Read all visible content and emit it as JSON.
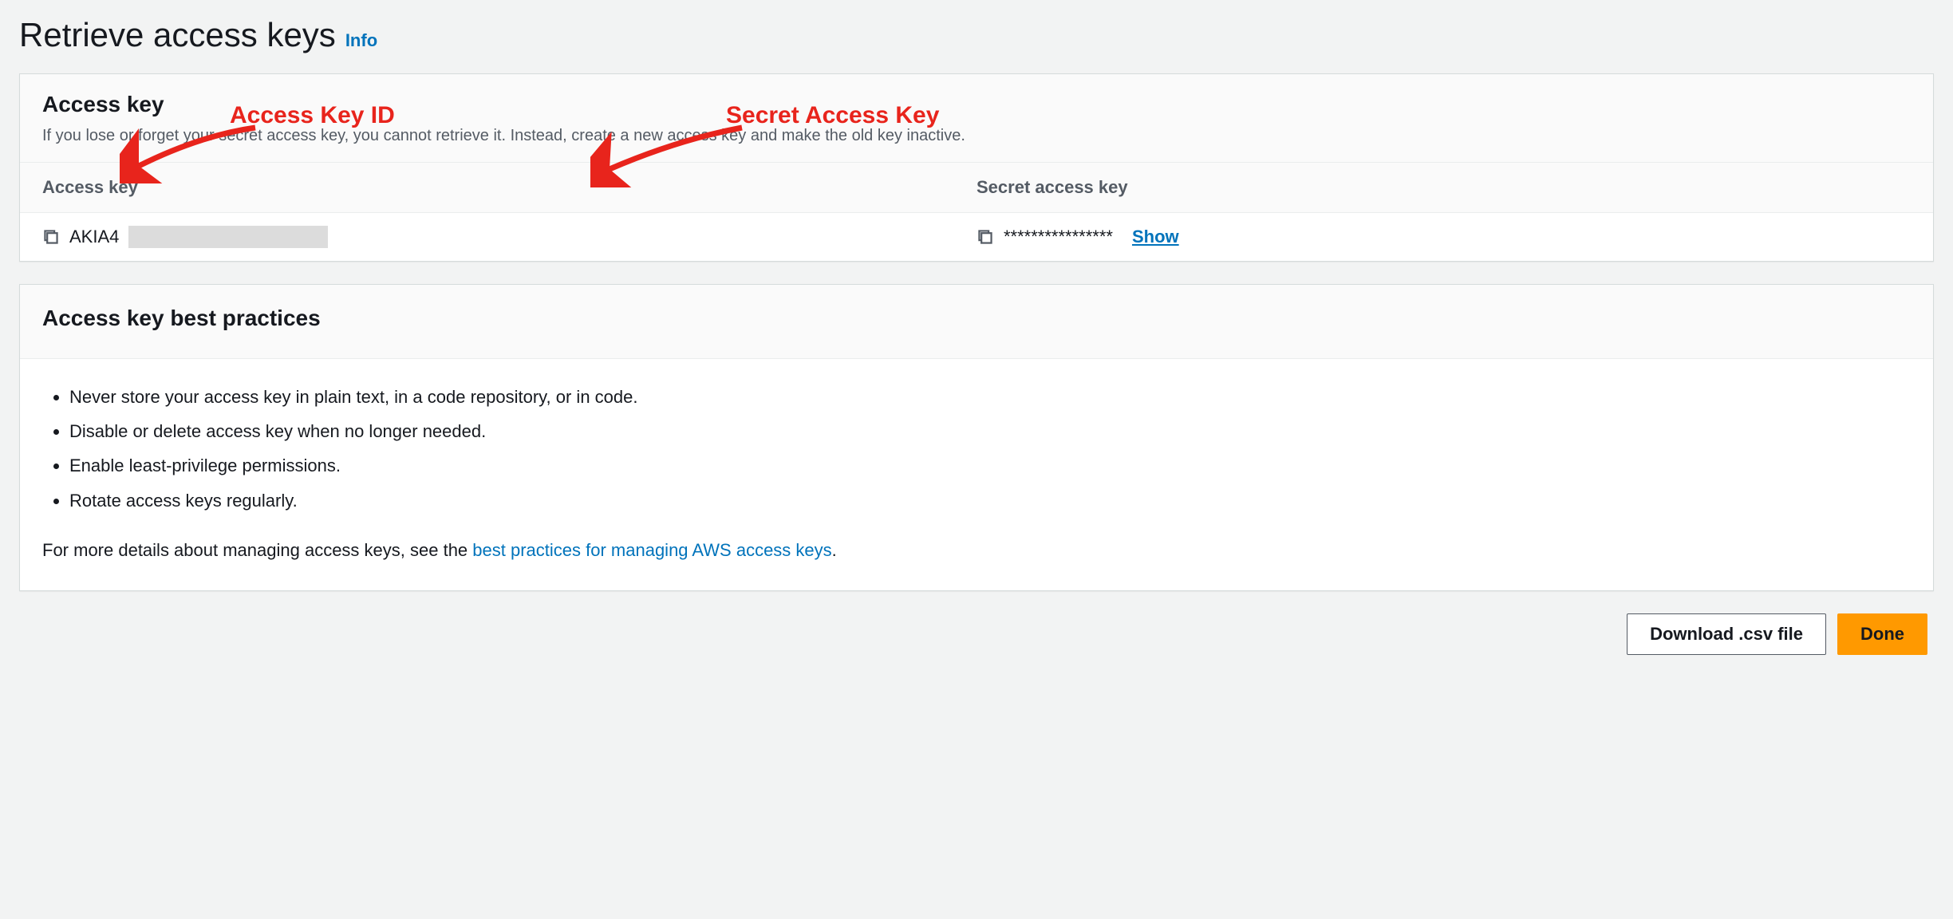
{
  "page": {
    "title": "Retrieve access keys",
    "info_label": "Info"
  },
  "access_key_panel": {
    "title": "Access key",
    "subtitle": "If you lose or forget your secret access key, you cannot retrieve it. Instead, create a new access key and make the old key inactive.",
    "columns": {
      "access_key": "Access key",
      "secret_access_key": "Secret access key"
    },
    "row": {
      "access_key_prefix": "AKIA4",
      "secret_masked": "****************",
      "show_label": "Show"
    }
  },
  "best_practices_panel": {
    "title": "Access key best practices",
    "items": [
      "Never store your access key in plain text, in a code repository, or in code.",
      "Disable or delete access key when no longer needed.",
      "Enable least-privilege permissions.",
      "Rotate access keys regularly."
    ],
    "details_prefix": "For more details about managing access keys, see the ",
    "details_link": "best practices for managing AWS access keys",
    "details_suffix": "."
  },
  "buttons": {
    "download": "Download .csv file",
    "done": "Done"
  },
  "annotations": {
    "access_key_id": "Access Key ID",
    "secret_access_key": "Secret Access Key"
  }
}
